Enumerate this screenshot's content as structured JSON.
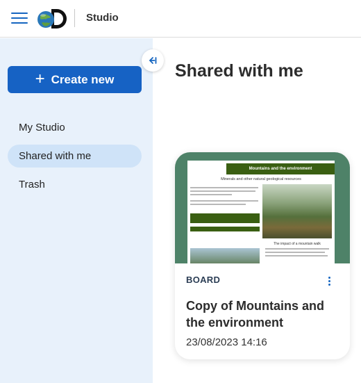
{
  "header": {
    "app_name": "Studio",
    "menu_icon": "hamburger-menu-icon",
    "logo_icon": "discovery-logo-icon"
  },
  "sidebar": {
    "create_label": "Create new",
    "create_icon": "plus-icon",
    "items": [
      {
        "label": "My Studio",
        "active": false
      },
      {
        "label": "Shared with me",
        "active": true
      },
      {
        "label": "Trash",
        "active": false
      }
    ],
    "collapse_icon": "collapse-left-arrow-icon"
  },
  "main": {
    "title": "Shared with me",
    "cards": [
      {
        "type": "BOARD",
        "title": "Copy of Mountains and the environment",
        "date": "23/08/2023 14:16",
        "menu_icon": "more-vertical-icon",
        "thumbnail": {
          "heading": "Mountains and the environment",
          "subheading": "Minerals and other natural geological resources",
          "section_title": "The impact of a mountain walk"
        }
      }
    ]
  },
  "colors": {
    "accent": "#1662c4",
    "sidebar_bg": "#e8f1fb",
    "active_item_bg": "#cfe3f8",
    "thumbnail_bg": "#4e8268"
  }
}
